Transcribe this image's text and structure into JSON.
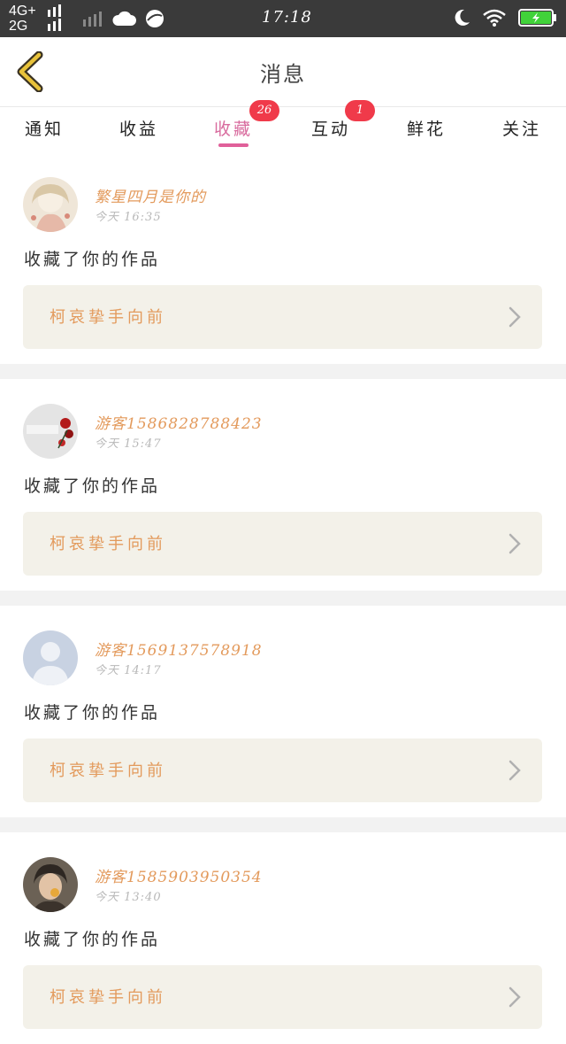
{
  "status_bar": {
    "network_1": "4G+",
    "network_2": "2G",
    "time": "17:18",
    "icons": [
      "signal-bars-icon",
      "cloud-icon",
      "browser-icon",
      "moon-icon",
      "wifi-icon",
      "battery-charging-icon"
    ],
    "battery_color": "#41d23a"
  },
  "header": {
    "title": "消息",
    "back_icon": "back-chevron-icon",
    "back_icon_color": "#e8c23a"
  },
  "tabs": [
    {
      "label": "通知",
      "active": false,
      "badge": ""
    },
    {
      "label": "收益",
      "active": false,
      "badge": ""
    },
    {
      "label": "收藏",
      "active": true,
      "badge": "26"
    },
    {
      "label": "互动",
      "active": false,
      "badge": "1"
    },
    {
      "label": "鲜花",
      "active": false,
      "badge": ""
    },
    {
      "label": "关注",
      "active": false,
      "badge": ""
    }
  ],
  "feed": [
    {
      "username": "繁星四月是你的",
      "time": "今天 16:35",
      "action": "收藏了你的作品",
      "work_title": "柯哀挚手向前",
      "avatar": "anime-girl-avatar"
    },
    {
      "username": "游客15868287884​23",
      "time": "今天 15:47",
      "action": "收藏了你的作品",
      "work_title": "柯哀挚手向前",
      "avatar": "rose-avatar"
    },
    {
      "username": "游客15691375789​18",
      "time": "今天 14:17",
      "action": "收藏了你的作品",
      "work_title": "柯哀挚手向前",
      "avatar": "default-person-avatar"
    },
    {
      "username": "游客15859039503​54",
      "time": "今天 13:40",
      "action": "收藏了你的作品",
      "work_title": "柯哀挚手向前",
      "avatar": "photo-avatar"
    }
  ],
  "colors": {
    "accent_pink": "#e0609a",
    "username_orange": "#e39a5c",
    "badge_red": "#f03a4a",
    "work_box_bg": "#f3f1e9"
  }
}
